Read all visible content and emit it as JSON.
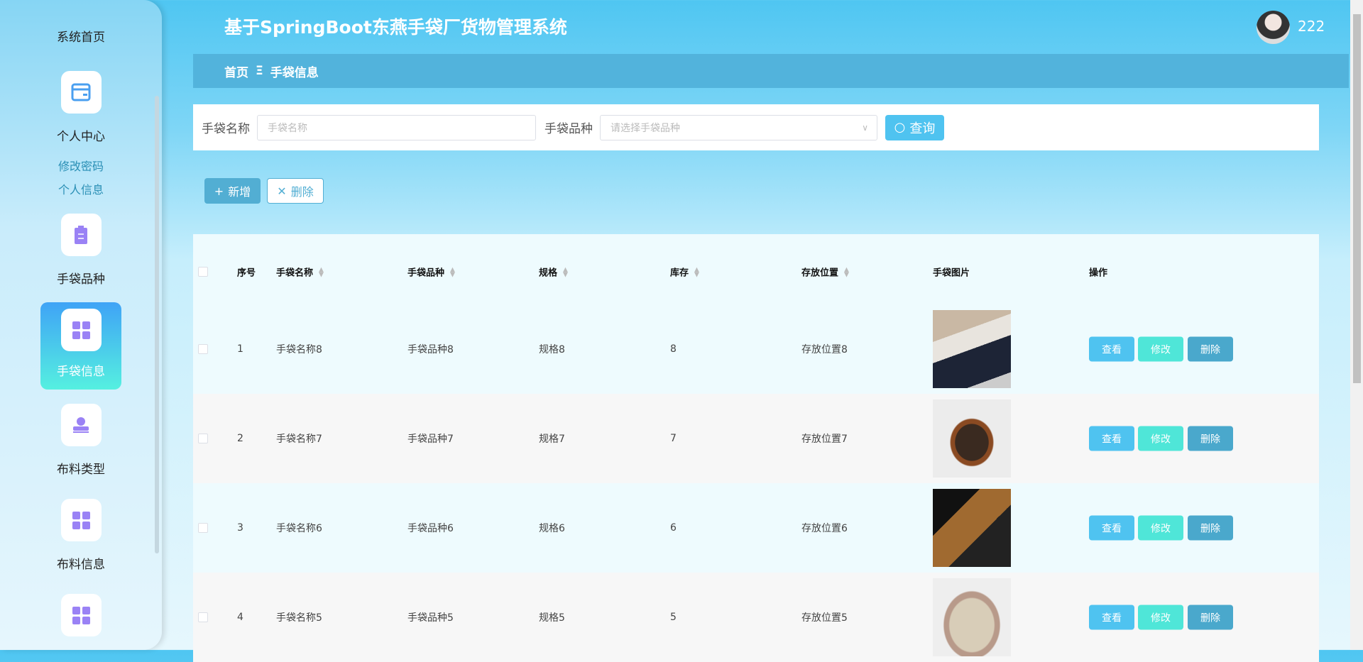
{
  "header": {
    "title": "基于SpringBoot东燕手袋厂货物管理系统",
    "username": "222"
  },
  "sidebar": {
    "items": [
      {
        "label": "系统首页",
        "icon": "home-icon"
      },
      {
        "label": "个人中心",
        "icon": "wallet-icon",
        "sub": [
          "修改密码",
          "个人信息"
        ]
      },
      {
        "label": "手袋品种",
        "icon": "clipboard-icon"
      },
      {
        "label": "手袋信息",
        "icon": "grid-icon",
        "active": true
      },
      {
        "label": "布料类型",
        "icon": "user-stamp-icon"
      },
      {
        "label": "布料信息",
        "icon": "grid-icon"
      },
      {
        "label": "",
        "icon": "grid-icon"
      }
    ]
  },
  "breadcrumb": {
    "home": "首页",
    "separator": "Ξ",
    "current": "手袋信息"
  },
  "search": {
    "name_label": "手袋名称",
    "name_placeholder": "手袋名称",
    "type_label": "手袋品种",
    "type_placeholder": "请选择手袋品种",
    "query_label": "查询"
  },
  "actions": {
    "add_label": "新增",
    "delete_label": "删除"
  },
  "table": {
    "columns": [
      "序号",
      "手袋名称",
      "手袋品种",
      "规格",
      "库存",
      "存放位置",
      "手袋图片",
      "操作"
    ],
    "rows": [
      {
        "no": "1",
        "name": "手袋名称8",
        "type": "手袋品种8",
        "spec": "规格8",
        "stock": "8",
        "location": "存放位置8"
      },
      {
        "no": "2",
        "name": "手袋名称7",
        "type": "手袋品种7",
        "spec": "规格7",
        "stock": "7",
        "location": "存放位置7"
      },
      {
        "no": "3",
        "name": "手袋名称6",
        "type": "手袋品种6",
        "spec": "规格6",
        "stock": "6",
        "location": "存放位置6"
      },
      {
        "no": "4",
        "name": "手袋名称5",
        "type": "手袋品种5",
        "spec": "规格5",
        "stock": "5",
        "location": "存放位置5"
      }
    ],
    "row_actions": {
      "view": "查看",
      "edit": "修改",
      "delete": "删除"
    }
  },
  "colors": {
    "view": "#4fc3f0",
    "edit": "#4fe6d8",
    "delete": "#4aa8cc",
    "breadcrumb": "#52b3dc"
  }
}
